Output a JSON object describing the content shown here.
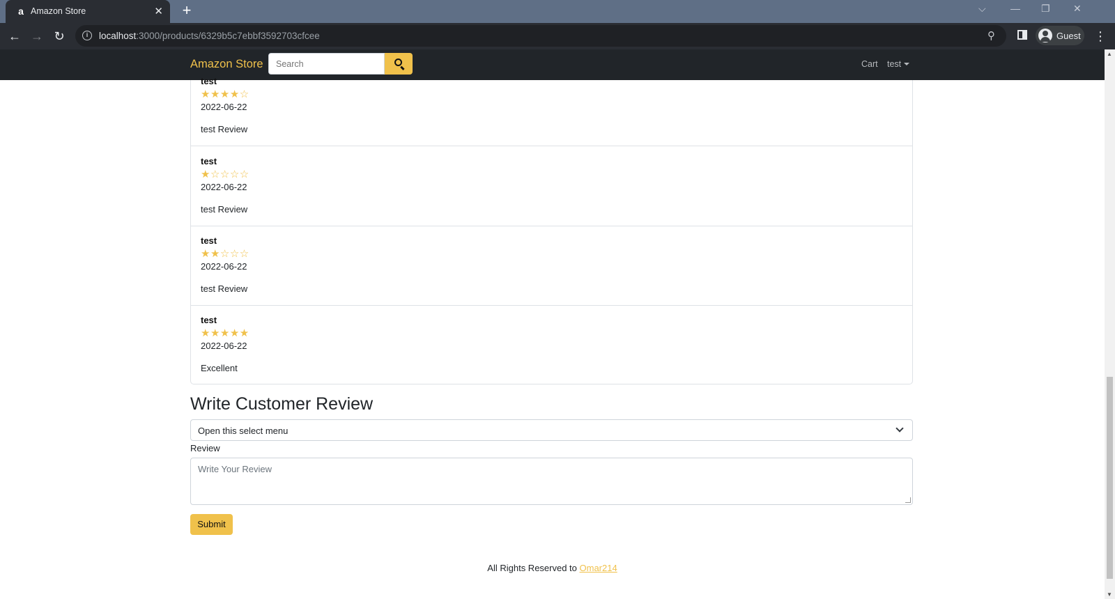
{
  "browser": {
    "tab_title": "Amazon Store",
    "tab_favicon": "a",
    "url_host": "localhost",
    "url_rest": ":3000/products/6329b5c7ebbf3592703cfcee",
    "profile_name": "Guest"
  },
  "navbar": {
    "brand": "Amazon Store",
    "search_placeholder": "Search",
    "cart_label": "Cart",
    "user_label": "test"
  },
  "reviews": [
    {
      "name": "test",
      "rating": 4,
      "stars": "★★★★☆",
      "date": "2022-06-22",
      "text": "test Review"
    },
    {
      "name": "test",
      "rating": 1,
      "stars": "★☆☆☆☆",
      "date": "2022-06-22",
      "text": "test Review"
    },
    {
      "name": "test",
      "rating": 2,
      "stars": "★★☆☆☆",
      "date": "2022-06-22",
      "text": "test Review"
    },
    {
      "name": "test",
      "rating": 5,
      "stars": "★★★★★",
      "date": "2022-06-22",
      "text": "Excellent"
    }
  ],
  "form": {
    "title": "Write Customer Review",
    "select_value": "Open this select menu",
    "review_label": "Review",
    "review_placeholder": "Write Your Review",
    "submit_label": "Submit"
  },
  "footer": {
    "text": "All Rights Reserved to ",
    "link": "Omar214"
  },
  "colors": {
    "accent": "#f0c14b",
    "navbar_bg": "#212529"
  }
}
